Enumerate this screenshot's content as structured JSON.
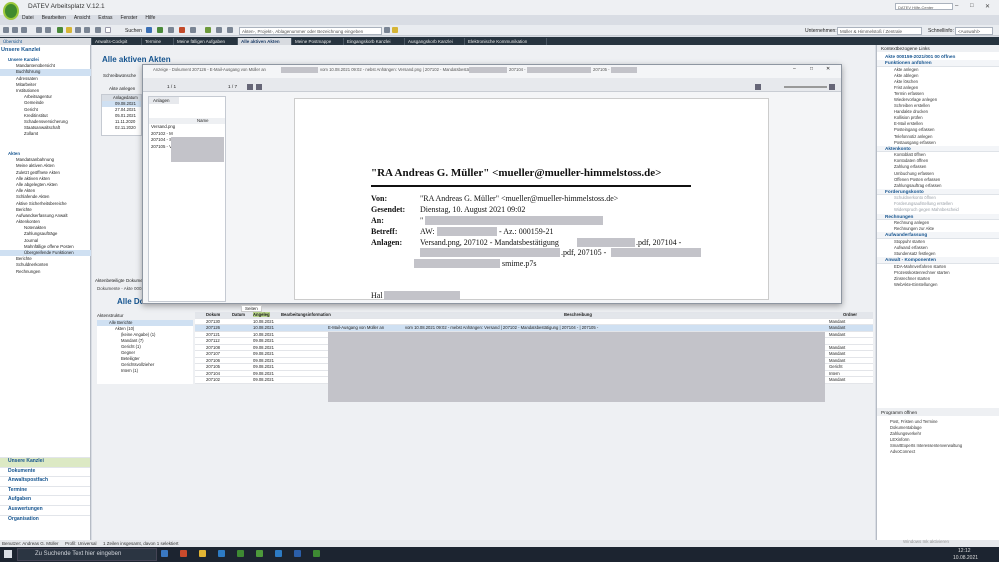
{
  "app": {
    "title": "DATEV Arbeitsplatz V.12.1",
    "menu": [
      "Datei",
      "Bearbeiten",
      "Ansicht",
      "Extras",
      "Fenster",
      "Hilfe"
    ],
    "search_label": "Suchen",
    "akten_search_placeholder": "Akten-, Projekt-, Ablagenummer oder Bezeichnung eingeben",
    "unternehmen_label": "Unternehmen:",
    "unternehmen_value": "Müller & Himmelstoß / Zentrale",
    "schnellinfo_label": "Schnellinfo:",
    "schnellinfo_value": "<Auswahl>",
    "hilfecenter_placeholder": "DATEV Hilfe-Center"
  },
  "tabs": [
    "Übersicht",
    "Anwalts-Cockpit",
    "Termine",
    "Meine fälligen Aufgaben",
    "Alle aktiven Akten",
    "Meine Postmappe",
    "Eingangskorb Kanzlei",
    "Ausgangskorb Kanzlei",
    "Elektronische Kommunikation"
  ],
  "left": {
    "header": "Unsere Kanzlei",
    "kanzlei_items": [
      "Mandantenübersicht",
      "Buchführung",
      "Adressaten",
      "Mitarbeiter",
      "Institutionen",
      "Arbeitsagentur",
      "Gemeinde",
      "Gericht",
      "Kreditinstitut",
      "Schadensversicherung",
      "Staatsanwaltschaft",
      "Zollamt"
    ],
    "akten_header": "Akten",
    "akten_items": [
      "Mandatsanbahnung",
      "Meine aktiven Akten",
      "Zuletzt geöffnete Akten",
      "Alle aktiven Akten",
      "Alle abgelegten Akten",
      "Alle Akten",
      "Schlafende Akten",
      "Aktive Sicherheitsbereiche",
      "Berichte",
      "Aufwandserfassung Anwalt",
      "Aktenkonten",
      "Notenakten",
      "Zahlungsaufträge",
      "Journal",
      "Mahnfällige offene Posten",
      "Übergreifende Funktionen",
      "Berichte",
      "Schuldnerkonten",
      "Rechnungen"
    ],
    "bottom_nav": [
      "Unsere Kanzlei",
      "Dokumente",
      "Anwaltspostfach",
      "Termine",
      "Aufgaben",
      "Auswertungen",
      "Organisation"
    ]
  },
  "center": {
    "page_title": "Alle aktiven Akten",
    "schreibwunsche": "Schreibwünsche",
    "akte_anlegen": "Akte anlegen",
    "col_anlagedatum": "Anlagedatum",
    "dates": [
      "09.08.2021",
      "27.04.2021",
      "05.01.2021",
      "11.11.2020",
      "02.11.2020"
    ],
    "lower_tabs": [
      "Aktenbeteiligte",
      "Dokume"
    ],
    "lower_title": "Alle Do",
    "dokumente_label": "Dokumente - Akte 0001",
    "aktenstruktur_label": "Aktenstruktur",
    "struktur": [
      "Alle Berichte",
      "Akten (10)",
      "(keine Angabe) (1)",
      "Mandant (7)",
      "Gericht (1)",
      "Gegner",
      "Beteiligter",
      "Gerichtsvollzieher",
      "Intern (1)"
    ],
    "grid_headers": [
      "Dokum",
      "Datum",
      "Angeleg",
      "Bearbeitungsinformation",
      "Beschreibung",
      "Ordner"
    ],
    "grid_rows": [
      {
        "nr": "207130",
        "datum": "",
        "angelegt": "10.08.2021",
        "info": "",
        "beschr": "",
        "ordner": "Mandant"
      },
      {
        "nr": "207126",
        "datum": "",
        "angelegt": "10.08.2021",
        "info": "E-Mail-Ausgang von Müller an",
        "beschr": "vom 10.08.2021 09:02 - mebst Anhängen: Versand | 207102 - Mandatsbestätigung | 207104 - | 207105 -",
        "ordner": "Mandant"
      },
      {
        "nr": "207121",
        "datum": "",
        "angelegt": "10.08.2021",
        "info": "",
        "beschr": "",
        "ordner": "Mandant"
      },
      {
        "nr": "207112",
        "datum": "",
        "angelegt": "09.08.2021",
        "info": "",
        "beschr": "",
        "ordner": ""
      },
      {
        "nr": "207108",
        "datum": "",
        "angelegt": "09.08.2021",
        "info": "",
        "beschr": "",
        "ordner": "Mandant"
      },
      {
        "nr": "207107",
        "datum": "",
        "angelegt": "09.08.2021",
        "info": "",
        "beschr": "",
        "ordner": "Mandant"
      },
      {
        "nr": "207106",
        "datum": "",
        "angelegt": "09.08.2021",
        "info": "",
        "beschr": "",
        "ordner": "Mandant"
      },
      {
        "nr": "207105",
        "datum": "",
        "angelegt": "09.08.2021",
        "info": "",
        "beschr": "",
        "ordner": "Gericht"
      },
      {
        "nr": "207104",
        "datum": "",
        "angelegt": "09.08.2021",
        "info": "",
        "beschr": "",
        "ordner": "Intern"
      },
      {
        "nr": "207102",
        "datum": "",
        "angelegt": "09.08.2021",
        "info": "",
        "beschr": "",
        "ordner": "Mandant"
      }
    ]
  },
  "modal": {
    "title": "Anzeige - Dokument 207126 - E-Mail-Ausgang von Müller an",
    "title_suffix": "vom 10.08.2021 09:02 - nebst Anhängen: Versand.png | 207102 - Mandatsbestätigung",
    "title_suffix2": "207104 -",
    "title_suffix3": "207105 -",
    "page_counter": "1 / 1",
    "page_counter2": "1 / 7",
    "anlagen_tab": "Anlagen",
    "seiten_tab": "Seiten",
    "col_name": "Name",
    "files": [
      "Versand.png",
      "207102 - M",
      "207104 - S",
      "207105 - V"
    ],
    "email": {
      "from_header": "\"RA Andreas G. Müller\" <mueller@mueller-himmelstoss.de>",
      "von_label": "Von:",
      "von_value": "\"RA Andreas G. Müller\" <mueller@mueller-himmelstoss.de>",
      "gesendet_label": "Gesendet:",
      "gesendet_value": "Dienstag, 10. August 2021 09:02",
      "an_label": "An:",
      "an_value": "\"",
      "betreff_label": "Betreff:",
      "betreff_prefix": "AW:",
      "betreff_suffix": "- Az.: 000159-21",
      "anlagen_label": "Anlagen:",
      "anlagen_line1a": "Versand.png, 207102 - Mandatsbestätigung",
      "anlagen_line1b": ".pdf, 207104 -",
      "anlagen_line2a": ".pdf, 207105 -",
      "anlagen_line3": "smime.p7s",
      "greeting": "Hal"
    }
  },
  "right": {
    "kontext": "Kontextbezogene Links",
    "akte_header": "Akte 000159-2021/001 00 öffnen",
    "groups": [
      {
        "title": "Funktionen anführen",
        "items": [
          "Akte anlegen",
          "Akte ablegen",
          "Akte löschen",
          "Frist anlegen",
          "Termin erfassen",
          "Wiedervorlage anlegen",
          "Schreiben erstellen",
          "Handakte drucken",
          "Kollision prüfen",
          "E-Mail erstellen",
          "Posteingang erfassen",
          "Telefonnotiz anlegen",
          "Postausgang erfassen"
        ]
      },
      {
        "title": "Aktenkonto",
        "items": [
          "Kontoblatt öffnen",
          "Kontodaten öffnen",
          "Zahlung erfassen",
          "Umbuchung erfassen",
          "Offenen Posten erfassen",
          "Zahlungsauftrag erfassen"
        ]
      },
      {
        "title": "Forderungskonto",
        "items": [
          "Schuldnerkonto öffnen",
          "Forderungsaufstellung erstellen",
          "Widerspruch gegen Mahnbescheid"
        ],
        "disabled": true
      },
      {
        "title": "Rechnungen",
        "items": [
          "Rechnung anlegen",
          "Rechnungen zur Akte"
        ]
      },
      {
        "title": "Aufwanderfassung",
        "items": [
          "Stoppuhr starten",
          "Aufwand erfassen",
          "Stundensatz festlegen"
        ]
      },
      {
        "title": "Anwalt - Komponenten",
        "items": [
          "EDA-Mahnverfahren starten",
          "Prozesskostenrechner starten",
          "Zinsrechner starten",
          "WebAkte-Einstellungen"
        ]
      }
    ],
    "programme_header": "Programm öffnen",
    "programme": [
      "Post, Fristen und Termine",
      "Dokumentablage",
      "Zahlungsverkehr",
      "LEXinform",
      "SmartExperts Interessentenverwaltung",
      "AdvoConnect"
    ]
  },
  "status": {
    "benutzer": "Benutzer: Andreas G. Müller",
    "profil": "Profil: Universal",
    "zeilen": "1 Zeilen insgesamt, davon 1 selektiert"
  },
  "taskbar": {
    "search_placeholder": "Zu Suchende Text hier eingeben",
    "time": "12:12",
    "date": "10.08.2021",
    "activate": "Windows Ink aktivieren"
  },
  "colors": {
    "accent": "#15548f",
    "datev_green": "#3f8a2e",
    "redaction": "#c3c3c9",
    "tab_bar": "#27343f"
  }
}
